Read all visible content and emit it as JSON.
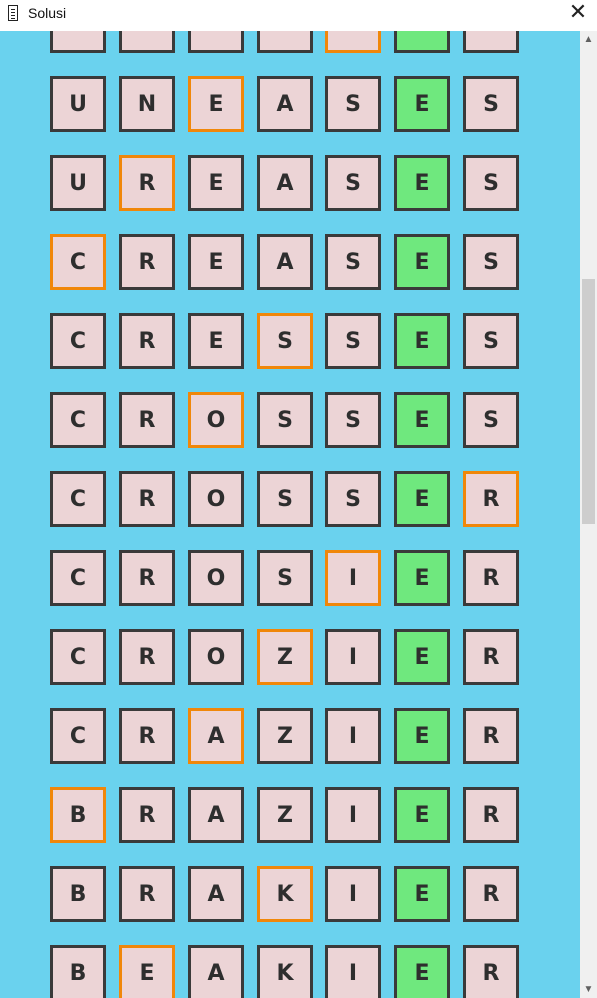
{
  "window": {
    "title": "Solusi",
    "close_symbol": "✕",
    "icon": "app-menu-icon"
  },
  "scrollbar": {
    "up_symbol": "▲",
    "down_symbol": "▼"
  },
  "colors": {
    "board_background": "#6ad2ee",
    "tile_background": "#ecd4d6",
    "tile_fixed_green": "#6fe87e",
    "changed_letter_border": "#f0870a",
    "tile_border": "#3a3a3a"
  },
  "solution_rows": [
    {
      "letters": [
        "",
        "",
        "",
        "",
        "",
        "",
        ""
      ],
      "changed": 4
    },
    {
      "letters": [
        "U",
        "N",
        "E",
        "A",
        "S",
        "E",
        "S"
      ],
      "changed": 2
    },
    {
      "letters": [
        "U",
        "R",
        "E",
        "A",
        "S",
        "E",
        "S"
      ],
      "changed": 1
    },
    {
      "letters": [
        "C",
        "R",
        "E",
        "A",
        "S",
        "E",
        "S"
      ],
      "changed": 0
    },
    {
      "letters": [
        "C",
        "R",
        "E",
        "S",
        "S",
        "E",
        "S"
      ],
      "changed": 3
    },
    {
      "letters": [
        "C",
        "R",
        "O",
        "S",
        "S",
        "E",
        "S"
      ],
      "changed": 2
    },
    {
      "letters": [
        "C",
        "R",
        "O",
        "S",
        "S",
        "E",
        "R"
      ],
      "changed": 6
    },
    {
      "letters": [
        "C",
        "R",
        "O",
        "S",
        "I",
        "E",
        "R"
      ],
      "changed": 4
    },
    {
      "letters": [
        "C",
        "R",
        "O",
        "Z",
        "I",
        "E",
        "R"
      ],
      "changed": 3
    },
    {
      "letters": [
        "C",
        "R",
        "A",
        "Z",
        "I",
        "E",
        "R"
      ],
      "changed": 2
    },
    {
      "letters": [
        "B",
        "R",
        "A",
        "Z",
        "I",
        "E",
        "R"
      ],
      "changed": 0
    },
    {
      "letters": [
        "B",
        "R",
        "A",
        "K",
        "I",
        "E",
        "R"
      ],
      "changed": 3
    },
    {
      "letters": [
        "B",
        "E",
        "A",
        "K",
        "I",
        "E",
        "R"
      ],
      "changed": 1
    }
  ],
  "fixed_green_column": 5
}
